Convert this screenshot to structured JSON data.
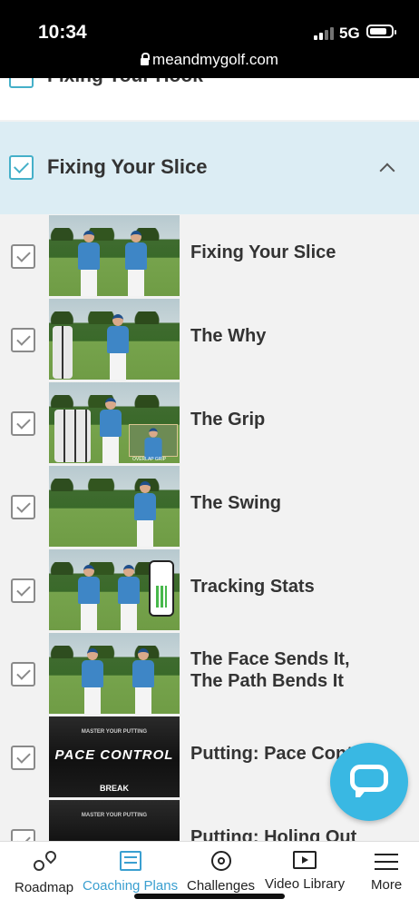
{
  "status_bar": {
    "time": "10:34",
    "network": "5G",
    "url": "meandmygolf.com"
  },
  "previous_section": {
    "title": "Fixing Your Hook"
  },
  "section": {
    "title": "Fixing Your Slice",
    "expanded": true,
    "checked": true
  },
  "lessons": [
    {
      "title_line1": "Fixing Your Slice",
      "title_line2": "",
      "checked": true
    },
    {
      "title_line1": "The Why",
      "title_line2": "",
      "checked": true
    },
    {
      "title_line1": "The Grip",
      "title_line2": "",
      "checked": true,
      "thumb_caption": "OVERLAP GRIP"
    },
    {
      "title_line1": "The Swing",
      "title_line2": "",
      "checked": true
    },
    {
      "title_line1": "Tracking Stats",
      "title_line2": "",
      "checked": true
    },
    {
      "title_line1": "The Face Sends It,",
      "title_line2": "The Path Bends It",
      "checked": true
    },
    {
      "title_line1": "Putting: Pace Control",
      "title_line2": "",
      "checked": true,
      "thumb_line1": "MASTER YOUR PUTTING",
      "thumb_line2": "PACE CONTROL",
      "thumb_line3": "BREAK"
    },
    {
      "title_line1": "Putting: Holing Out",
      "title_line2": "",
      "checked": true,
      "thumb_line1": "MASTER YOUR PUTTING"
    }
  ],
  "tabs": [
    {
      "label": "Roadmap",
      "icon": "route-icon",
      "active": false
    },
    {
      "label": "Coaching Plans",
      "icon": "list-icon",
      "active": true
    },
    {
      "label": "Challenges",
      "icon": "target-icon",
      "active": false
    },
    {
      "label": "Video Library",
      "icon": "video-icon",
      "active": false
    },
    {
      "label": "More",
      "icon": "menu-icon",
      "active": false
    }
  ],
  "colors": {
    "accent": "#3a9fd0",
    "section_bg": "#dcedf4",
    "chat_button": "#39b8e3"
  }
}
